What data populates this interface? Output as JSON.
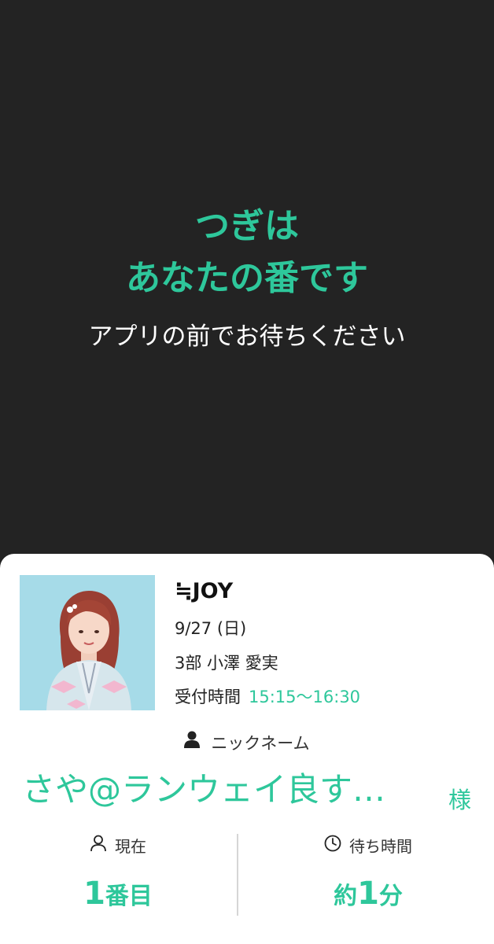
{
  "hero": {
    "title_line1": "つぎは",
    "title_line2": "あなたの番です",
    "subtitle": "アプリの前でお待ちください"
  },
  "event": {
    "group": "≒JOY",
    "date": "9/27 (日)",
    "session": "3部  小澤 愛実",
    "reception_label": "受付時間",
    "reception_time": "15:15〜16:30"
  },
  "nickname": {
    "label": "ニックネーム",
    "value": "さや@ランウェイ良す…",
    "honorific": "様"
  },
  "status": {
    "current_label": "現在",
    "current_number": "1",
    "current_unit": "番目",
    "wait_label": "待ち時間",
    "wait_prefix": "約",
    "wait_number": "1",
    "wait_unit": "分"
  },
  "icons": {
    "nickname": "person-icon",
    "current": "person-outline-icon",
    "wait": "clock-icon"
  },
  "colors": {
    "accent": "#2ec79b",
    "background": "#232323",
    "card": "#ffffff"
  }
}
